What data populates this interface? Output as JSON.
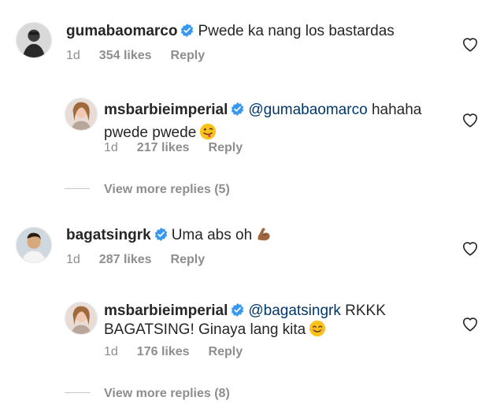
{
  "comments": [
    {
      "username": "gumabaomarco",
      "text": "Pwede ka nang los bastardas",
      "time": "1d",
      "likes": "354 likes",
      "reply": "Reply",
      "replies": [
        {
          "username": "msbarbieimperial",
          "mention": "@gumabaomarco",
          "text_line1": "hahaha",
          "text_line2": "pwede pwede",
          "emoji": "winking-tongue-emoji",
          "time": "1d",
          "likes": "217 likes",
          "reply": "Reply"
        }
      ],
      "view_more": "View more replies (5)"
    },
    {
      "username": "bagatsingrk",
      "text": "Uma abs oh",
      "emoji": "flexed-biceps-emoji",
      "time": "1d",
      "likes": "287 likes",
      "reply": "Reply",
      "replies": [
        {
          "username": "msbarbieimperial",
          "mention": "@bagatsingrk",
          "text_line1": "RKKK",
          "text_line2": "BAGATSING! Ginaya lang kita",
          "emoji": "smiling-face-emoji",
          "time": "1d",
          "likes": "176 likes",
          "reply": "Reply"
        }
      ],
      "view_more": "View more replies (8)"
    }
  ],
  "icons": {
    "verified": "verified-badge-icon",
    "like": "heart-outline-icon"
  },
  "colors": {
    "verified_blue": "#3897f0",
    "mention": "#00376b",
    "secondary_text": "#8e8e8e"
  }
}
